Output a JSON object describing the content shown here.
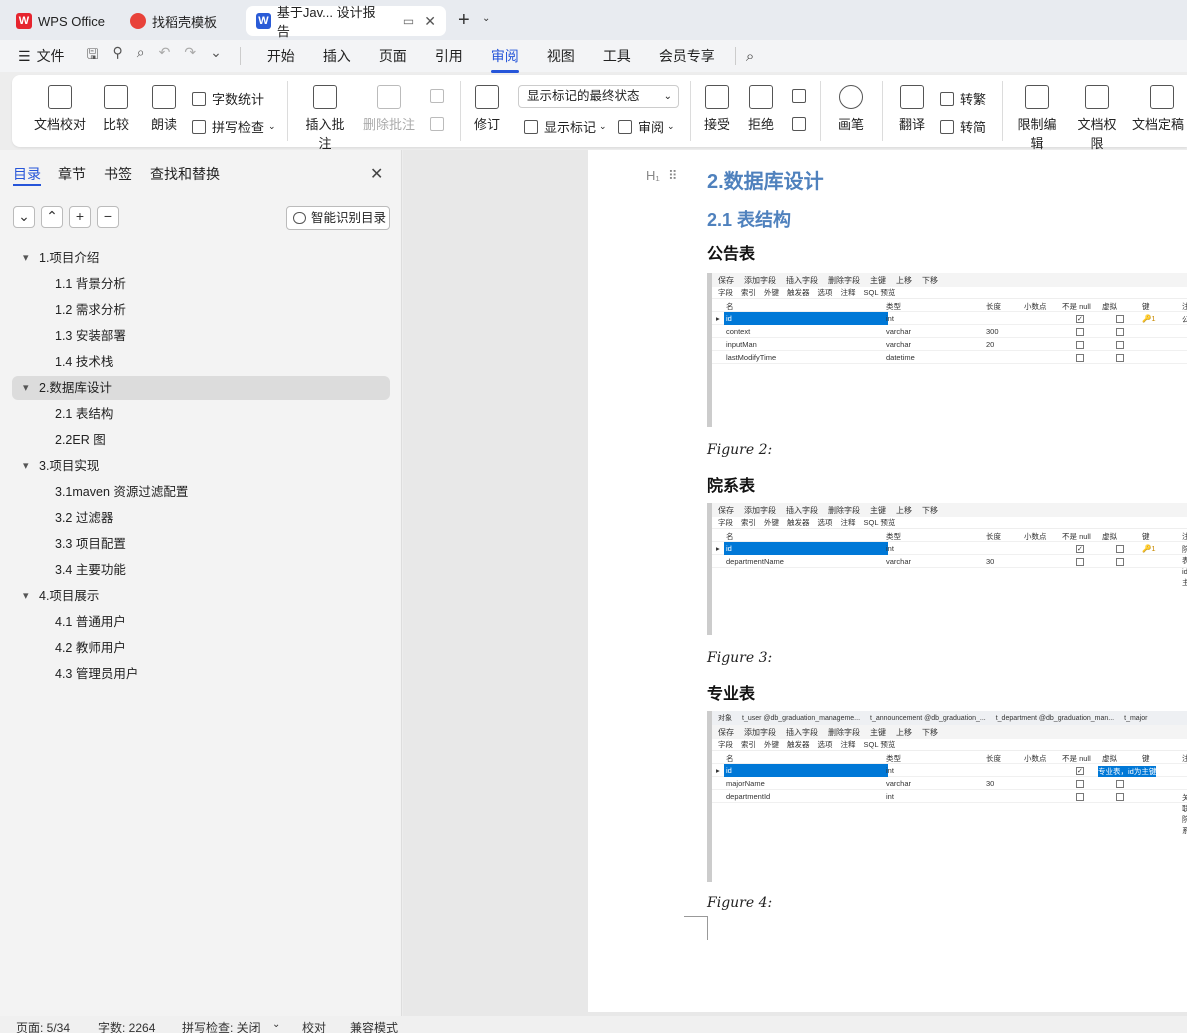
{
  "tabs": [
    {
      "label": "WPS Office",
      "icon": "wps-logo"
    },
    {
      "label": "找稻壳模板",
      "icon": "docer-icon"
    },
    {
      "label": "基于Jav... 设计报告",
      "icon": "word-doc-icon"
    }
  ],
  "menu": {
    "file": "文件",
    "items": [
      "开始",
      "插入",
      "页面",
      "引用",
      "审阅",
      "视图",
      "工具",
      "会员专享"
    ],
    "active": "审阅"
  },
  "ribbon": {
    "proof": "文档校对",
    "compare": "比较",
    "read": "朗读",
    "wordcount": "字数统计",
    "spellcheck": "拼写检查",
    "insert_comment": "插入批注",
    "delete_comment": "删除批注",
    "revise": "修订",
    "display_state": "显示标记的最终状态",
    "show_marks": "显示标记",
    "review": "审阅",
    "accept": "接受",
    "reject": "拒绝",
    "pen": "画笔",
    "translate": "翻译",
    "to_trad": "转繁",
    "to_simp": "转简",
    "restrict": "限制编辑",
    "permission": "文档权限",
    "finalize": "文档定稿"
  },
  "sidebar": {
    "tabs": [
      "目录",
      "章节",
      "书签",
      "查找和替换"
    ],
    "smart_btn": "智能识别目录",
    "toc": [
      {
        "label": "1.项目介绍",
        "level": 1,
        "selected": false
      },
      {
        "label": "1.1 背景分析",
        "level": 2,
        "selected": false
      },
      {
        "label": "1.2 需求分析",
        "level": 2,
        "selected": false
      },
      {
        "label": "1.3 安装部署",
        "level": 2,
        "selected": false
      },
      {
        "label": "1.4 技术栈",
        "level": 2,
        "selected": false
      },
      {
        "label": "2.数据库设计",
        "level": 1,
        "selected": true
      },
      {
        "label": "2.1 表结构",
        "level": 2,
        "selected": false
      },
      {
        "label": "2.2ER 图",
        "level": 2,
        "selected": false
      },
      {
        "label": "3.项目实现",
        "level": 1,
        "selected": false
      },
      {
        "label": "3.1maven 资源过滤配置",
        "level": 2,
        "selected": false
      },
      {
        "label": "3.2 过滤器",
        "level": 2,
        "selected": false
      },
      {
        "label": "3.3 项目配置",
        "level": 2,
        "selected": false
      },
      {
        "label": "3.4 主要功能",
        "level": 2,
        "selected": false
      },
      {
        "label": "4.项目展示",
        "level": 1,
        "selected": false
      },
      {
        "label": "4.1 普通用户",
        "level": 2,
        "selected": false
      },
      {
        "label": "4.2 教师用户",
        "level": 2,
        "selected": false
      },
      {
        "label": "4.3 管理员用户",
        "level": 2,
        "selected": false
      }
    ]
  },
  "doc": {
    "heading_marker": "H₁",
    "h1": "2.数据库设计",
    "h2": "2.1 表结构",
    "tables": [
      {
        "title": "公告表",
        "caption": "Figure 2:"
      },
      {
        "title": "院系表",
        "caption": "Figure 3:"
      },
      {
        "title": "专业表",
        "caption": "Figure 4:"
      }
    ],
    "shot_toolbar": [
      "保存",
      "添加字段",
      "插入字段",
      "删除字段",
      "主键",
      "上移",
      "下移"
    ],
    "shot_tabs": [
      "字段",
      "索引",
      "外键",
      "触发器",
      "选项",
      "注释",
      "SQL 预览"
    ],
    "shot_headers": [
      "名",
      "类型",
      "长度",
      "小数点",
      "不是 null",
      "虚拟",
      "键",
      "注"
    ],
    "shot3_objtabs": [
      "对象",
      "t_user @db_graduation_manageme...",
      "t_announcement @db_graduation_...",
      "t_department @db_graduation_man...",
      "t_major"
    ],
    "rows1": [
      [
        "id",
        "int",
        "",
        "",
        true,
        false,
        "1",
        "公"
      ],
      [
        "context",
        "varchar",
        "300",
        "",
        false,
        false,
        "",
        ""
      ],
      [
        "inputMan",
        "varchar",
        "20",
        "",
        false,
        false,
        "",
        ""
      ],
      [
        "lastModifyTime",
        "datetime",
        "",
        "",
        false,
        false,
        "",
        ""
      ]
    ],
    "rows2": [
      [
        "id",
        "int",
        "",
        "",
        true,
        false,
        "1",
        "院系表，id为主键"
      ],
      [
        "departmentName",
        "varchar",
        "30",
        "",
        false,
        false,
        "",
        ""
      ]
    ],
    "rows3": [
      [
        "id",
        "int",
        "",
        "",
        true,
        false,
        "1",
        "专业表，id为主键"
      ],
      [
        "majorName",
        "varchar",
        "30",
        "",
        false,
        false,
        "",
        ""
      ],
      [
        "departmentId",
        "int",
        "",
        "",
        false,
        false,
        "",
        "关联院系"
      ]
    ]
  },
  "status": {
    "page": "页面: 5/34",
    "words": "字数: 2264",
    "spell": "拼写检查: 关闭",
    "proof": "校对",
    "compat": "兼容模式"
  },
  "colors": {
    "accent": "#2655d9",
    "heading": "#4f81bd",
    "select": "#0078d7"
  }
}
